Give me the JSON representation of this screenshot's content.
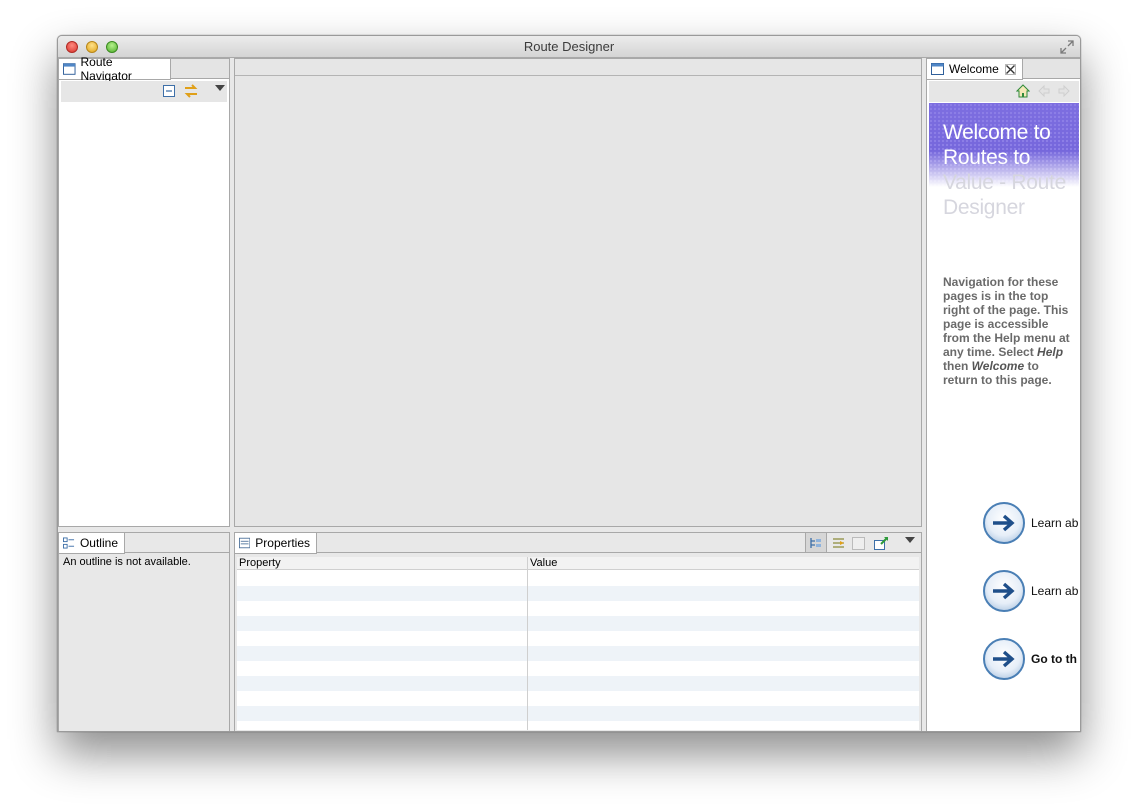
{
  "window": {
    "title": "Route Designer"
  },
  "navigator": {
    "tab_label": "Route Navigator"
  },
  "outline": {
    "tab_label": "Outline",
    "message": "An outline is not available."
  },
  "properties": {
    "tab_label": "Properties",
    "columns": [
      "Property",
      "Value"
    ]
  },
  "welcome": {
    "tab_label": "Welcome",
    "title_line1": "Welcome to",
    "title_line2": "Routes to",
    "title_line3": "Value - Route",
    "title_line4": "Designer",
    "body_part1": "Navigation for these pages is in the top right of the page. This page is accessible from the Help menu at any time. Select ",
    "body_help": "Help",
    "body_then": " then ",
    "body_welcome": "Welcome",
    "body_part2": " to return to this page.",
    "links": [
      "Learn ab",
      "Learn ab",
      "Go to th"
    ]
  },
  "colors": {
    "accent": "#6b5dd6",
    "link_ring": "#4a7fb5",
    "alt_row": "#eef3f8"
  },
  "icons": {
    "navigator_tab": "view-icon",
    "collapse": "collapse-all-icon",
    "link": "link-with-editor-icon",
    "home": "home-icon",
    "back": "back-icon",
    "forward": "forward-icon"
  }
}
